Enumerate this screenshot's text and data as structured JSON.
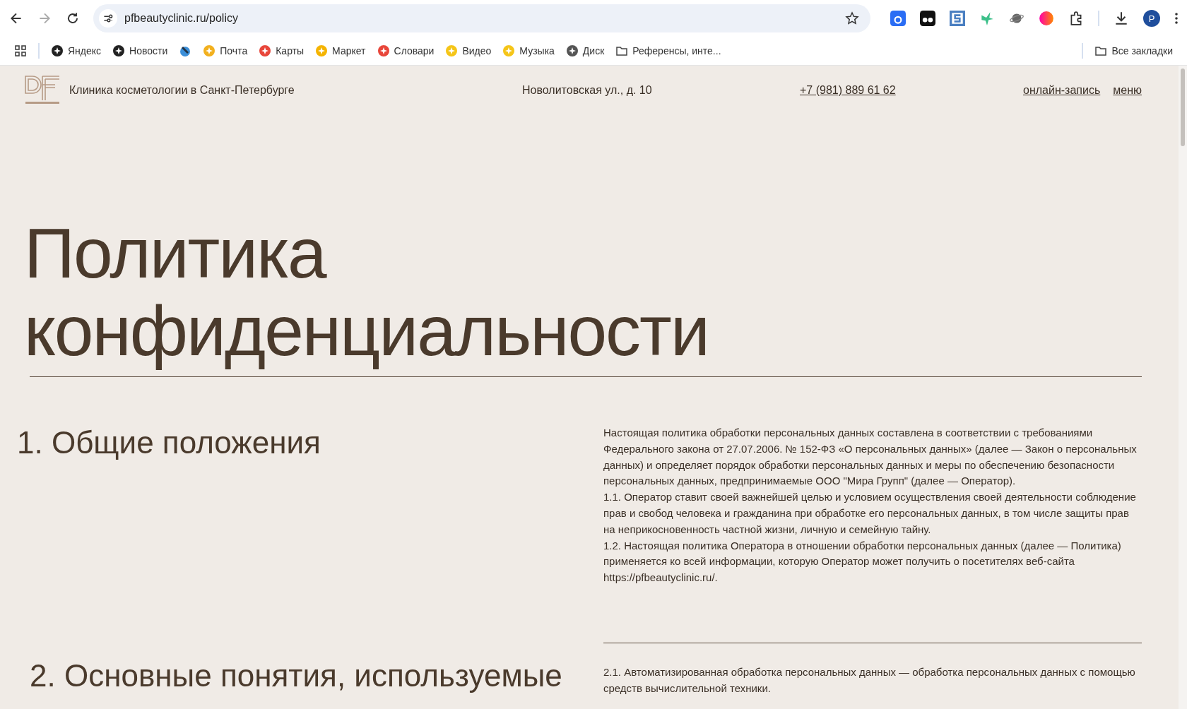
{
  "browser": {
    "address": "pfbeautyclinic.ru/policy",
    "profile_initial": "P",
    "bookmarks": [
      {
        "kind": "site",
        "label": "Яндекс"
      },
      {
        "kind": "site",
        "label": "Новости"
      },
      {
        "kind": "icon"
      },
      {
        "kind": "site",
        "label": "Почта"
      },
      {
        "kind": "site",
        "label": "Карты"
      },
      {
        "kind": "site",
        "label": "Маркет"
      },
      {
        "kind": "site",
        "label": "Словари"
      },
      {
        "kind": "site",
        "label": "Видео"
      },
      {
        "kind": "site",
        "label": "Музыка"
      },
      {
        "kind": "site",
        "label": "Диск"
      },
      {
        "kind": "folder",
        "label": "Референсы, инте..."
      }
    ],
    "all_bookmarks": "Все закладки"
  },
  "header": {
    "tagline": "Клиника косметологии в Санкт-Петербурге",
    "address": "Новолитовская ул., д. 10",
    "phone": "+7 (981) 889 61 62",
    "links": [
      "онлайн-запись",
      "меню"
    ]
  },
  "title": "Политика конфиденциальности",
  "sections": [
    {
      "heading": "1. Общие положения",
      "paragraphs": [
        "Настоящая политика обработки персональных данных составлена в соответствии с требованиями Федерального закона от 27.07.2006. № 152-ФЗ «О персональных данных» (далее — Закон о персональных данных) и определяет порядок обработки персональных данных и меры по обеспечению безопасности персональных данных, предпринимаемые ООО \"Мира Групп\" (далее — Оператор).",
        "1.1. Оператор ставит своей важнейшей целью и условием осуществления своей деятельности соблюдение прав и свобод человека и гражданина при обработке его персональных данных, в том числе защиты прав на неприкосновенность частной жизни, личную и семейную тайну.",
        "1.2. Настоящая политика Оператора в отношении обработки персональных данных (далее — Политика) применяется ко всей информации, которую Оператор может получить о посетителях веб-сайта https://pfbeautyclinic.ru/."
      ]
    },
    {
      "heading": "2. Основные понятия, используемые",
      "paragraphs": [
        "2.1. Автоматизированная обработка персональных данных — обработка персональных данных с помощью средств вычислительной техники."
      ]
    }
  ]
}
